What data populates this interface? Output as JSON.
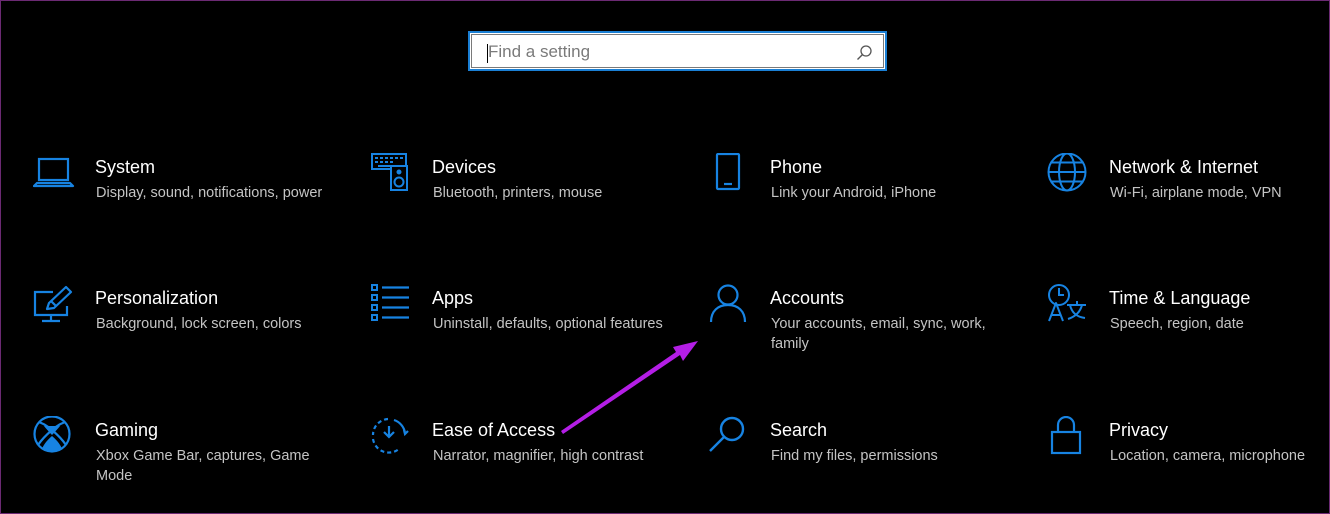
{
  "search": {
    "placeholder": "Find a setting"
  },
  "tiles": [
    {
      "title": "System",
      "desc": "Display, sound, notifications, power",
      "icon": "laptop-icon"
    },
    {
      "title": "Devices",
      "desc": "Bluetooth, printers, mouse",
      "icon": "keyboard-speaker-icon"
    },
    {
      "title": "Phone",
      "desc": "Link your Android, iPhone",
      "icon": "phone-icon"
    },
    {
      "title": "Network & Internet",
      "desc": "Wi-Fi, airplane mode, VPN",
      "icon": "globe-icon"
    },
    {
      "title": "Personalization",
      "desc": "Background, lock screen, colors",
      "icon": "paint-monitor-icon"
    },
    {
      "title": "Apps",
      "desc": "Uninstall, defaults, optional features",
      "icon": "apps-list-icon"
    },
    {
      "title": "Accounts",
      "desc": "Your accounts, email, sync, work, family",
      "icon": "person-icon"
    },
    {
      "title": "Time & Language",
      "desc": "Speech, region, date",
      "icon": "time-language-icon"
    },
    {
      "title": "Gaming",
      "desc": "Xbox Game Bar, captures, Game Mode",
      "icon": "xbox-icon"
    },
    {
      "title": "Ease of Access",
      "desc": "Narrator, magnifier, high contrast",
      "icon": "ease-of-access-icon"
    },
    {
      "title": "Search",
      "desc": "Find my files, permissions",
      "icon": "magnifier-icon"
    },
    {
      "title": "Privacy",
      "desc": "Location, camera, microphone",
      "icon": "lock-icon"
    }
  ],
  "colors": {
    "background": "#000000",
    "accent": "#1a7fd4",
    "icon": "#1783e2",
    "title": "#ffffff",
    "description": "#c4c4c4",
    "annotation_arrow": "#b41ee6"
  }
}
